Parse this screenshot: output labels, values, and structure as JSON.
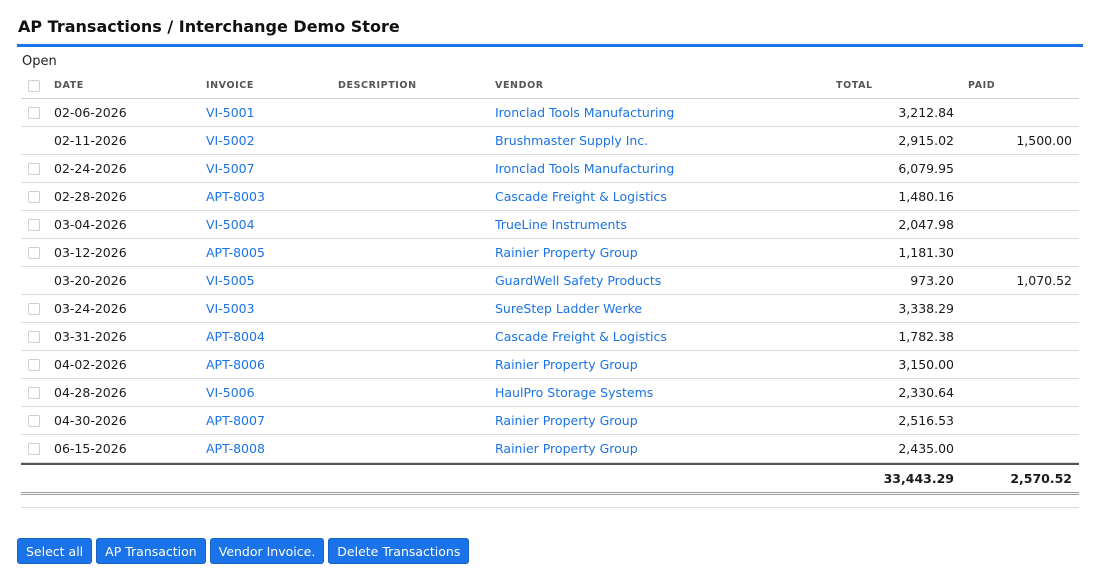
{
  "page": {
    "title": "AP Transactions / Interchange Demo Store",
    "section_label": "Open"
  },
  "colors": {
    "accent": "#1a73e8",
    "link": "#1a73e8"
  },
  "table": {
    "headers": {
      "date": "DATE",
      "invoice": "INVOICE",
      "description": "DESCRIPTION",
      "vendor": "VENDOR",
      "total": "TOTAL",
      "paid": "PAID"
    },
    "rows": [
      {
        "checkbox": true,
        "date": "02-06-2026",
        "invoice": "VI-5001",
        "description": "",
        "vendor": "Ironclad Tools Manufacturing",
        "total": "3,212.84",
        "paid": ""
      },
      {
        "checkbox": false,
        "date": "02-11-2026",
        "invoice": "VI-5002",
        "description": "",
        "vendor": "Brushmaster Supply Inc.",
        "total": "2,915.02",
        "paid": "1,500.00"
      },
      {
        "checkbox": true,
        "date": "02-24-2026",
        "invoice": "VI-5007",
        "description": "",
        "vendor": "Ironclad Tools Manufacturing",
        "total": "6,079.95",
        "paid": ""
      },
      {
        "checkbox": true,
        "date": "02-28-2026",
        "invoice": "APT-8003",
        "description": "",
        "vendor": "Cascade Freight & Logistics",
        "total": "1,480.16",
        "paid": ""
      },
      {
        "checkbox": true,
        "date": "03-04-2026",
        "invoice": "VI-5004",
        "description": "",
        "vendor": "TrueLine Instruments",
        "total": "2,047.98",
        "paid": ""
      },
      {
        "checkbox": true,
        "date": "03-12-2026",
        "invoice": "APT-8005",
        "description": "",
        "vendor": "Rainier Property Group",
        "total": "1,181.30",
        "paid": ""
      },
      {
        "checkbox": false,
        "date": "03-20-2026",
        "invoice": "VI-5005",
        "description": "",
        "vendor": "GuardWell Safety Products",
        "total": "973.20",
        "paid": "1,070.52"
      },
      {
        "checkbox": true,
        "date": "03-24-2026",
        "invoice": "VI-5003",
        "description": "",
        "vendor": "SureStep Ladder Werke",
        "total": "3,338.29",
        "paid": ""
      },
      {
        "checkbox": true,
        "date": "03-31-2026",
        "invoice": "APT-8004",
        "description": "",
        "vendor": "Cascade Freight & Logistics",
        "total": "1,782.38",
        "paid": ""
      },
      {
        "checkbox": true,
        "date": "04-02-2026",
        "invoice": "APT-8006",
        "description": "",
        "vendor": "Rainier Property Group",
        "total": "3,150.00",
        "paid": ""
      },
      {
        "checkbox": true,
        "date": "04-28-2026",
        "invoice": "VI-5006",
        "description": "",
        "vendor": "HaulPro Storage Systems",
        "total": "2,330.64",
        "paid": ""
      },
      {
        "checkbox": true,
        "date": "04-30-2026",
        "invoice": "APT-8007",
        "description": "",
        "vendor": "Rainier Property Group",
        "total": "2,516.53",
        "paid": ""
      },
      {
        "checkbox": true,
        "date": "06-15-2026",
        "invoice": "APT-8008",
        "description": "",
        "vendor": "Rainier Property Group",
        "total": "2,435.00",
        "paid": ""
      }
    ],
    "totals": {
      "total": "33,443.29",
      "paid": "2,570.52"
    }
  },
  "buttons": {
    "select_all": "Select all",
    "ap_transaction": "AP Transaction",
    "vendor_invoice": "Vendor Invoice.",
    "delete_transactions": "Delete Transactions"
  }
}
